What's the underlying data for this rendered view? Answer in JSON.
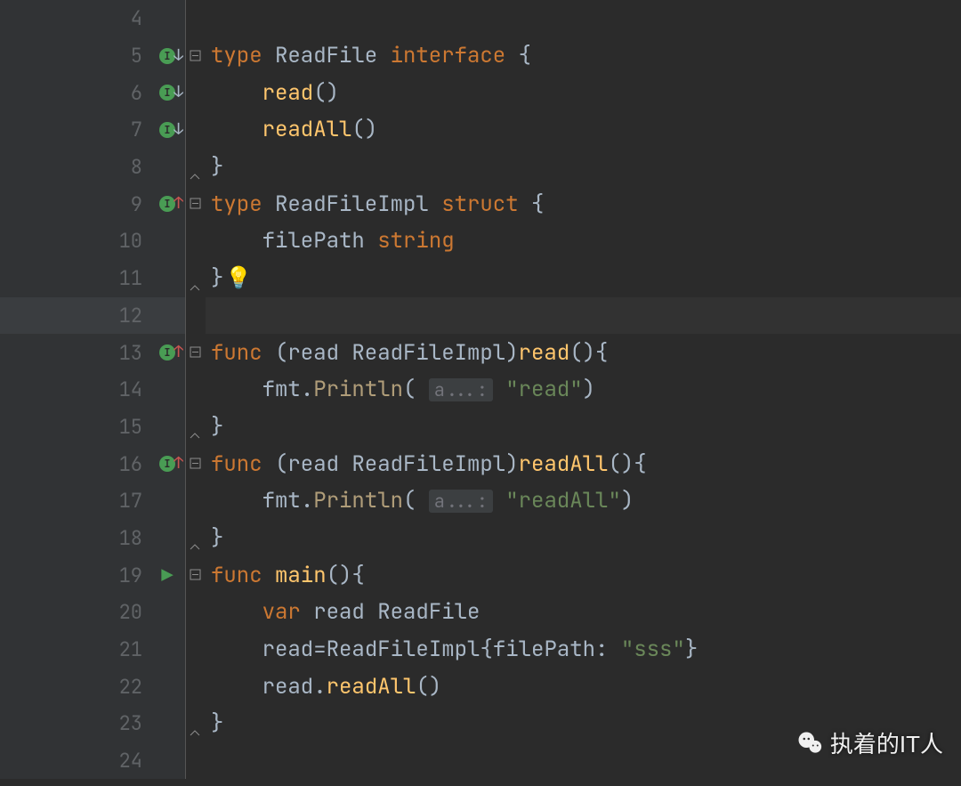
{
  "editor_theme": {
    "bg": "#2b2b2b",
    "gutter_bg": "#313335",
    "keyword": "#cc7832",
    "function": "#ffc66d",
    "string": "#6a8759",
    "line_number": "#606366"
  },
  "current_line": 12,
  "watermark": {
    "text": "执着的IT人",
    "icon": "wechat"
  },
  "gutter_annotations": {
    "5": {
      "icon": "implements",
      "arrow": "down",
      "fold": "open"
    },
    "6": {
      "icon": "implements",
      "arrow": "down"
    },
    "7": {
      "icon": "implements",
      "arrow": "down"
    },
    "8": {
      "fold": "close"
    },
    "9": {
      "icon": "implements",
      "arrow": "up-red",
      "fold": "open"
    },
    "11": {
      "fold": "close",
      "bulb": true
    },
    "13": {
      "icon": "implements",
      "arrow": "up-red",
      "fold": "open"
    },
    "15": {
      "fold": "close"
    },
    "16": {
      "icon": "implements",
      "arrow": "up-red",
      "fold": "open"
    },
    "18": {
      "fold": "close"
    },
    "19": {
      "icon": "run",
      "fold": "open"
    },
    "23": {
      "fold": "close"
    }
  },
  "lines": [
    {
      "num": 4,
      "tokens": []
    },
    {
      "num": 5,
      "tokens": [
        {
          "cls": "kw",
          "t": "type "
        },
        {
          "cls": "typ",
          "t": "ReadFile "
        },
        {
          "cls": "kw",
          "t": "interface"
        },
        {
          "cls": "punct",
          "t": " {"
        }
      ]
    },
    {
      "num": 6,
      "tokens": [
        {
          "cls": "",
          "t": "    "
        },
        {
          "cls": "fn",
          "t": "read"
        },
        {
          "cls": "punct",
          "t": "()"
        }
      ]
    },
    {
      "num": 7,
      "tokens": [
        {
          "cls": "",
          "t": "    "
        },
        {
          "cls": "fn",
          "t": "readAll"
        },
        {
          "cls": "punct",
          "t": "()"
        }
      ]
    },
    {
      "num": 8,
      "tokens": [
        {
          "cls": "punct",
          "t": "}"
        }
      ]
    },
    {
      "num": 9,
      "tokens": [
        {
          "cls": "kw",
          "t": "type "
        },
        {
          "cls": "typ",
          "t": "ReadFileImpl "
        },
        {
          "cls": "kw",
          "t": "struct"
        },
        {
          "cls": "punct",
          "t": " {"
        }
      ]
    },
    {
      "num": 10,
      "tokens": [
        {
          "cls": "",
          "t": "    "
        },
        {
          "cls": "ident",
          "t": "filePath "
        },
        {
          "cls": "kw",
          "t": "string"
        }
      ]
    },
    {
      "num": 11,
      "tokens": [
        {
          "cls": "punct",
          "t": "}"
        }
      ],
      "bulb": true
    },
    {
      "num": 12,
      "tokens": []
    },
    {
      "num": 13,
      "tokens": [
        {
          "cls": "kw",
          "t": "func "
        },
        {
          "cls": "punct",
          "t": "("
        },
        {
          "cls": "recv",
          "t": "read "
        },
        {
          "cls": "typ",
          "t": "ReadFileImpl"
        },
        {
          "cls": "punct",
          "t": ")"
        },
        {
          "cls": "fn",
          "t": "read"
        },
        {
          "cls": "punct",
          "t": "(){"
        }
      ]
    },
    {
      "num": 14,
      "tokens": [
        {
          "cls": "",
          "t": "    "
        },
        {
          "cls": "pkg",
          "t": "fmt"
        },
        {
          "cls": "punct",
          "t": "."
        },
        {
          "cls": "call",
          "t": "Println"
        },
        {
          "cls": "punct",
          "t": "( "
        },
        {
          "cls": "param",
          "t": "a...:"
        },
        {
          "cls": "punct",
          "t": " "
        },
        {
          "cls": "str",
          "t": "\"read\""
        },
        {
          "cls": "punct",
          "t": ")"
        }
      ]
    },
    {
      "num": 15,
      "tokens": [
        {
          "cls": "punct",
          "t": "}"
        }
      ]
    },
    {
      "num": 16,
      "tokens": [
        {
          "cls": "kw",
          "t": "func "
        },
        {
          "cls": "punct",
          "t": "("
        },
        {
          "cls": "recv",
          "t": "read "
        },
        {
          "cls": "typ",
          "t": "ReadFileImpl"
        },
        {
          "cls": "punct",
          "t": ")"
        },
        {
          "cls": "fn",
          "t": "readAll"
        },
        {
          "cls": "punct",
          "t": "(){"
        }
      ]
    },
    {
      "num": 17,
      "tokens": [
        {
          "cls": "",
          "t": "    "
        },
        {
          "cls": "pkg",
          "t": "fmt"
        },
        {
          "cls": "punct",
          "t": "."
        },
        {
          "cls": "call",
          "t": "Println"
        },
        {
          "cls": "punct",
          "t": "( "
        },
        {
          "cls": "param",
          "t": "a...:"
        },
        {
          "cls": "punct",
          "t": " "
        },
        {
          "cls": "str",
          "t": "\"readAll\""
        },
        {
          "cls": "punct",
          "t": ")"
        }
      ]
    },
    {
      "num": 18,
      "tokens": [
        {
          "cls": "punct",
          "t": "}"
        }
      ]
    },
    {
      "num": 19,
      "tokens": [
        {
          "cls": "kw",
          "t": "func "
        },
        {
          "cls": "fn",
          "t": "main"
        },
        {
          "cls": "punct",
          "t": "(){"
        }
      ]
    },
    {
      "num": 20,
      "tokens": [
        {
          "cls": "",
          "t": "    "
        },
        {
          "cls": "kw",
          "t": "var "
        },
        {
          "cls": "ident",
          "t": "read "
        },
        {
          "cls": "typ",
          "t": "ReadFile"
        }
      ]
    },
    {
      "num": 21,
      "tokens": [
        {
          "cls": "",
          "t": "    "
        },
        {
          "cls": "ident",
          "t": "read"
        },
        {
          "cls": "punct",
          "t": "="
        },
        {
          "cls": "typ",
          "t": "ReadFileImpl"
        },
        {
          "cls": "punct",
          "t": "{"
        },
        {
          "cls": "ident",
          "t": "filePath"
        },
        {
          "cls": "punct",
          "t": ": "
        },
        {
          "cls": "str",
          "t": "\"sss\""
        },
        {
          "cls": "punct",
          "t": "}"
        }
      ]
    },
    {
      "num": 22,
      "tokens": [
        {
          "cls": "",
          "t": "    "
        },
        {
          "cls": "ident",
          "t": "read"
        },
        {
          "cls": "punct",
          "t": "."
        },
        {
          "cls": "fn",
          "t": "readAll"
        },
        {
          "cls": "punct",
          "t": "()"
        }
      ]
    },
    {
      "num": 23,
      "tokens": [
        {
          "cls": "punct",
          "t": "}"
        }
      ]
    },
    {
      "num": 24,
      "tokens": []
    }
  ]
}
